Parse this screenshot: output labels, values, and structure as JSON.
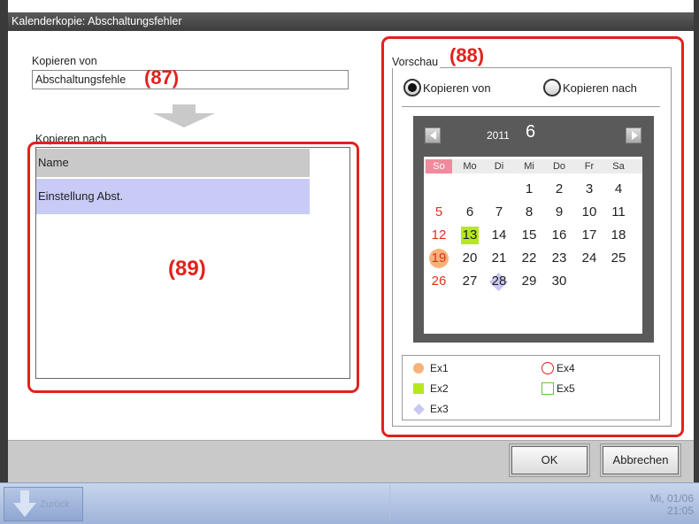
{
  "window": {
    "title": "Kalenderkopie: Abschaltungsfehler"
  },
  "source": {
    "label": "Kopieren von",
    "value": "Abschaltungsfehle"
  },
  "target": {
    "label": "Kopieren nach",
    "header": "Name",
    "rows": [
      "Einstellung Abst."
    ]
  },
  "preview": {
    "label": "Vorschau",
    "radio_from": "Kopieren von",
    "radio_to": "Kopieren nach",
    "selected": "from"
  },
  "calendar": {
    "year": "2011",
    "month": "6",
    "weekdays": [
      "So",
      "Mo",
      "Di",
      "Mi",
      "Do",
      "Fr",
      "Sa"
    ],
    "weeks": [
      [
        "",
        "",
        "",
        "1",
        "2",
        "3",
        "4"
      ],
      [
        "5",
        "6",
        "7",
        "8",
        "9",
        "10",
        "11"
      ],
      [
        "12",
        "13",
        "14",
        "15",
        "16",
        "17",
        "18"
      ],
      [
        "19",
        "20",
        "21",
        "22",
        "23",
        "24",
        "25"
      ],
      [
        "26",
        "27",
        "28",
        "29",
        "30",
        "",
        ""
      ]
    ],
    "marks": {
      "Ex1": "19",
      "Ex2": "13",
      "Ex3": "28"
    }
  },
  "legend": {
    "ex1": "Ex1",
    "ex2": "Ex2",
    "ex3": "Ex3",
    "ex4": "Ex4",
    "ex5": "Ex5"
  },
  "callouts": {
    "source": "(87)",
    "preview": "(88)",
    "target": "(89)"
  },
  "buttons": {
    "ok": "OK",
    "cancel": "Abbrechen"
  },
  "taskbar": {
    "back_label": "Zurück",
    "date": "Mi, 01/06",
    "time": "21:05"
  },
  "colors": {
    "callout": "#e3211c",
    "ex1": "#f7b27a",
    "ex2": "#b6e81e",
    "ex3": "#c8c8f2",
    "ex4": "#e3211c",
    "ex5": "#6fbf3b",
    "selected_row": "#c8cbf5"
  }
}
